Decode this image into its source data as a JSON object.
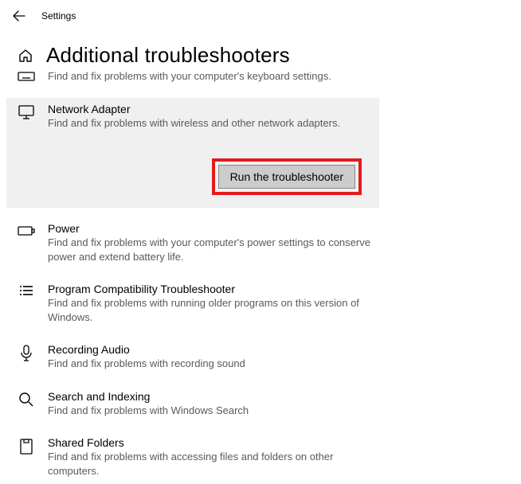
{
  "header": {
    "title": "Settings"
  },
  "page": {
    "title": "Additional troubleshooters"
  },
  "keyboard": {
    "desc": "Find and fix problems with your computer's keyboard settings."
  },
  "network": {
    "title": "Network Adapter",
    "desc": "Find and fix problems with wireless and other network adapters.",
    "run_label": "Run the troubleshooter"
  },
  "power": {
    "title": "Power",
    "desc": "Find and fix problems with your computer's power settings to conserve power and extend battery life."
  },
  "compat": {
    "title": "Program Compatibility Troubleshooter",
    "desc": "Find and fix problems with running older programs on this version of Windows."
  },
  "recording": {
    "title": "Recording Audio",
    "desc": "Find and fix problems with recording sound"
  },
  "search": {
    "title": "Search and Indexing",
    "desc": "Find and fix problems with Windows Search"
  },
  "shared": {
    "title": "Shared Folders",
    "desc": "Find and fix problems with accessing files and folders on other computers."
  }
}
